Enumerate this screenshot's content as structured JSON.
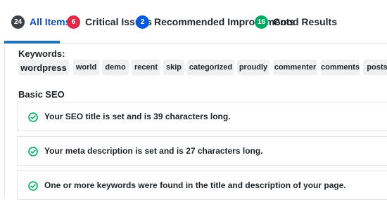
{
  "tabs": [
    {
      "count": "24",
      "label": "All Items",
      "color": "#3c434a"
    },
    {
      "count": "6",
      "label": "Critical Issues",
      "color": "#df2a4a"
    },
    {
      "count": "2",
      "label": "Recommended Improvements",
      "color": "#005ae0"
    },
    {
      "count": "16",
      "label": "Good Results",
      "color": "#00aa63"
    }
  ],
  "keywords": {
    "label": "Keywords:",
    "items": [
      "wordpress",
      "world",
      "demo",
      "recent",
      "skip",
      "categorized",
      "proudly",
      "commenter",
      "comments",
      "posts"
    ]
  },
  "basic_seo": {
    "title": "Basic SEO",
    "items": [
      {
        "status": "check-circle-icon",
        "text": "Your SEO title is set and is 39 characters long."
      },
      {
        "status": "check-circle-icon",
        "text": "Your meta description is set and is 27 characters long."
      },
      {
        "status": "check-circle-icon",
        "text": "One or more keywords were found in the title and description of your page."
      }
    ]
  },
  "colors": {
    "active_tab": "#0f4fbe",
    "good": "#00aa63"
  }
}
